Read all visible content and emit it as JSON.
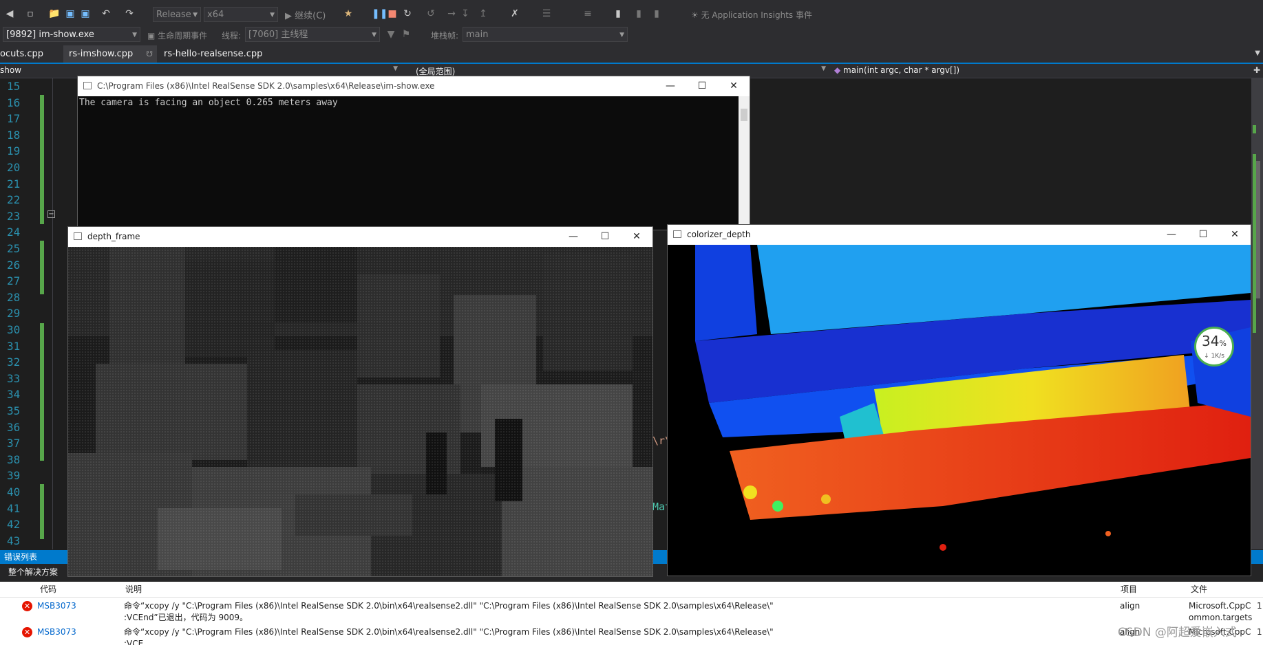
{
  "toolbar": {
    "config": "Release",
    "platform": "x64",
    "continue_label": "继续(C)",
    "app_insights": "无 Application Insights 事件"
  },
  "debugbar": {
    "process": "[9892] im-show.exe",
    "lifecycle": "生命周期事件",
    "thread_label": "线程:",
    "thread_value": "[7060] 主线程",
    "stack_label": "堆栈帧:",
    "stack_value": "main"
  },
  "tabs": [
    "ocuts.cpp",
    "rs-imshow.cpp",
    "rs-hello-realsense.cpp"
  ],
  "navbar": {
    "project": "show",
    "scope": "(全局范围)",
    "function": "main(int argc, char * argv[])"
  },
  "line_numbers": [
    "15",
    "16",
    "17",
    "18",
    "19",
    "20",
    "21",
    "22",
    "23",
    "24",
    "25",
    "26",
    "27",
    "28",
    "29",
    "30",
    "31",
    "32",
    "33",
    "34",
    "35",
    "36",
    "37",
    "38",
    "39",
    "40",
    "41",
    "42",
    "43"
  ],
  "console_window": {
    "title": "C:\\Program Files (x86)\\Intel RealSense SDK 2.0\\samples\\x64\\Release\\im-show.exe",
    "output": "The camera is facing an object 0.265 meters away"
  },
  "depth_window": {
    "title": "depth_frame"
  },
  "color_window": {
    "title": "colorizer_depth"
  },
  "code_fragments": [
    "\\r\\",
    "Mat"
  ],
  "net_widget": {
    "percent": "34",
    "unit": "%",
    "speed": "1K/s"
  },
  "error_list": {
    "title": "错误列表",
    "scope": "整个解决方案",
    "columns": {
      "code": "代码",
      "description": "说明",
      "project": "项目",
      "file": "文件"
    },
    "rows": [
      {
        "code": "MSB3073",
        "desc1": "命令“xcopy /y \"C:\\Program Files (x86)\\Intel RealSense SDK 2.0\\bin\\x64\\realsense2.dll\" \"C:\\Program Files (x86)\\Intel RealSense SDK 2.0\\samples\\x64\\Release\\\"",
        "desc2": ":VCEnd”已退出，代码为 9009。",
        "project": "align",
        "file1": "Microsoft.CppC",
        "file2": "ommon.targets",
        "line": "1"
      },
      {
        "code": "MSB3073",
        "desc1": "命令“xcopy /y \"C:\\Program Files (x86)\\Intel RealSense SDK 2.0\\bin\\x64\\realsense2.dll\" \"C:\\Program Files (x86)\\Intel RealSense SDK 2.0\\samples\\x64\\Release\\\"",
        "desc2": ":VCE...",
        "project": "align",
        "file1": "Microsoft.CppC",
        "file2": "",
        "line": "1"
      }
    ]
  },
  "watermark": "CSDN @阿超爱嵌入式",
  "colors": {
    "accent": "#007acc",
    "line_number": "#2b91af",
    "change_bar": "#57a64a",
    "error": "#e51400"
  }
}
